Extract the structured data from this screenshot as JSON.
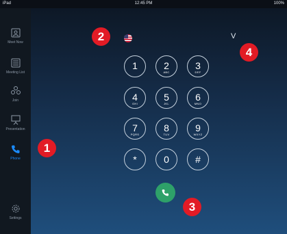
{
  "status_bar": {
    "carrier": "iPad",
    "time": "12:45 PM",
    "battery": "100%"
  },
  "sidebar": {
    "items": [
      {
        "label": "Meet Now",
        "icon": "meet-now-icon",
        "active": false
      },
      {
        "label": "Meeting List",
        "icon": "meeting-list-icon",
        "active": false
      },
      {
        "label": "Join",
        "icon": "join-icon",
        "active": false
      },
      {
        "label": "Presentation",
        "icon": "presentation-icon",
        "active": false
      },
      {
        "label": "Phone",
        "icon": "phone-icon",
        "active": true
      },
      {
        "label": "Settings",
        "icon": "settings-icon",
        "active": false
      }
    ]
  },
  "dialer": {
    "country_flag": "us-flag-icon",
    "input_value": "V",
    "keys": [
      {
        "digit": "1",
        "letters": ""
      },
      {
        "digit": "2",
        "letters": "ABC"
      },
      {
        "digit": "3",
        "letters": "DEF"
      },
      {
        "digit": "4",
        "letters": "GHI"
      },
      {
        "digit": "5",
        "letters": "JKL"
      },
      {
        "digit": "6",
        "letters": "MNO"
      },
      {
        "digit": "7",
        "letters": "PQRS"
      },
      {
        "digit": "8",
        "letters": "TUV"
      },
      {
        "digit": "9",
        "letters": "WXYZ"
      },
      {
        "digit": "*",
        "letters": ""
      },
      {
        "digit": "0",
        "letters": ""
      },
      {
        "digit": "#",
        "letters": ""
      }
    ],
    "call_icon": "phone-icon"
  },
  "annotations": [
    "1",
    "2",
    "3",
    "4"
  ],
  "colors": {
    "accent": "#1c8cff",
    "call": "#2ea169",
    "badge": "#e21b25"
  }
}
